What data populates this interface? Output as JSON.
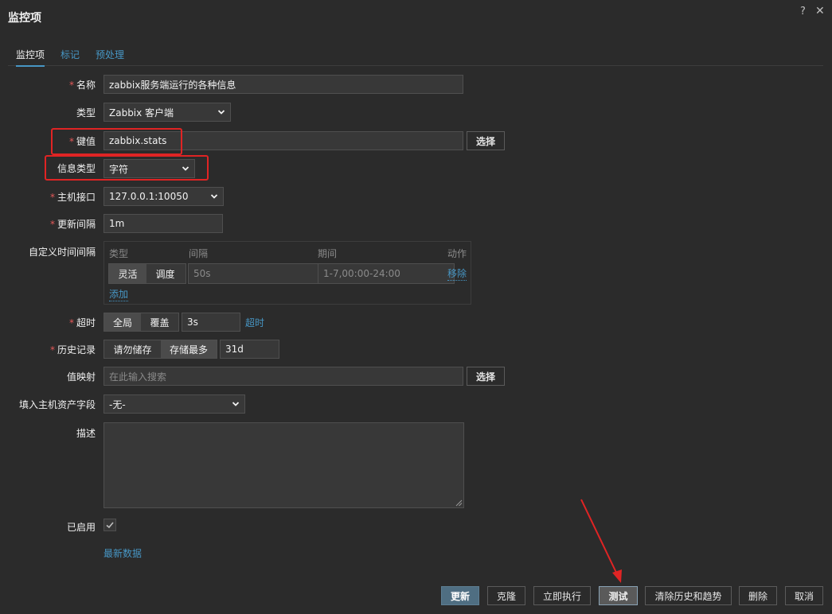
{
  "dialog": {
    "title": "监控项",
    "help_icon": "?",
    "close_icon": "✕"
  },
  "tabs": [
    {
      "label": "监控项",
      "active": true
    },
    {
      "label": "标记",
      "active": false
    },
    {
      "label": "预处理",
      "active": false
    }
  ],
  "form": {
    "name": {
      "label": "名称",
      "required": true,
      "value": "zabbix服务端运行的各种信息"
    },
    "type": {
      "label": "类型",
      "value": "Zabbix 客户端"
    },
    "key": {
      "label": "键值",
      "required": true,
      "value": "zabbix.stats",
      "select_label": "选择"
    },
    "info_type": {
      "label": "信息类型",
      "value": "字符"
    },
    "interface": {
      "label": "主机接口",
      "required": true,
      "value": "127.0.0.1:10050"
    },
    "update_interval": {
      "label": "更新间隔",
      "required": true,
      "value": "1m"
    },
    "custom_intervals": {
      "label": "自定义时间间隔",
      "headers": {
        "type": "类型",
        "interval": "间隔",
        "period": "期间",
        "action": "动作"
      },
      "row": {
        "flexible": "灵活",
        "scheduling": "调度",
        "interval_placeholder": "50s",
        "period_placeholder": "1-7,00:00-24:00",
        "remove": "移除"
      },
      "add": "添加"
    },
    "timeout": {
      "label": "超时",
      "required": true,
      "global": "全局",
      "override": "覆盖",
      "value": "3s",
      "link": "超时"
    },
    "history": {
      "label": "历史记录",
      "required": true,
      "no_store": "请勿储存",
      "store_up_to": "存储最多",
      "value": "31d"
    },
    "value_map": {
      "label": "值映射",
      "placeholder": "在此输入搜索",
      "select_label": "选择"
    },
    "inventory": {
      "label": "填入主机资产字段",
      "value": "-无-"
    },
    "description": {
      "label": "描述",
      "value": ""
    },
    "enabled": {
      "label": "已启用",
      "checked": true
    },
    "latest_data": "最新数据"
  },
  "footer": {
    "update": "更新",
    "clone": "克隆",
    "execute_now": "立即执行",
    "test": "测试",
    "clear_history": "清除历史和趋势",
    "delete": "删除",
    "cancel": "取消"
  },
  "colors": {
    "accent": "#4796c4",
    "required": "#e45959",
    "annotation": "#e02424",
    "bg": "#2b2b2b"
  }
}
